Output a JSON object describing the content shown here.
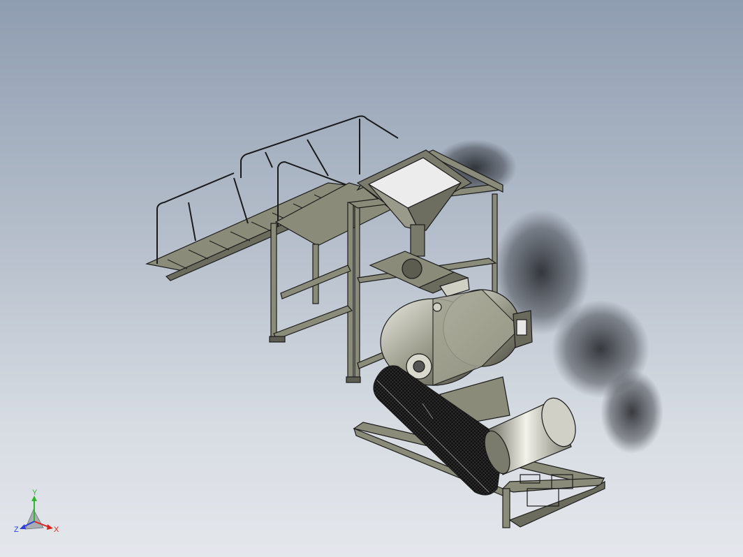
{
  "viewport": {
    "background_top": "#8f9db1",
    "background_bottom": "#e4e7ec",
    "model_color": "#8b8b7a",
    "edge_color": "#1a1a1a"
  },
  "triad": {
    "x_label": "X",
    "y_label": "Y",
    "z_label": "Z",
    "x_color": "#d9261c",
    "y_color": "#2fb52f",
    "z_color": "#2b3fd6"
  }
}
